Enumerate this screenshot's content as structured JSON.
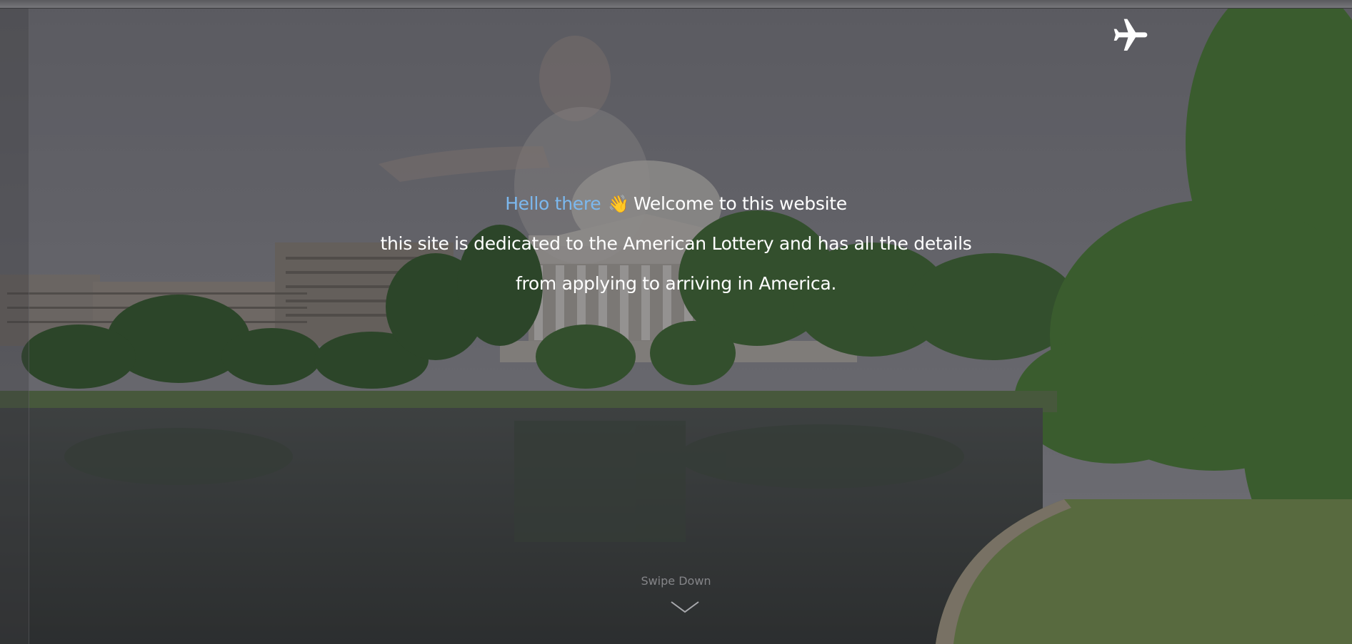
{
  "hero": {
    "greeting_highlight": "Hello there",
    "greeting_emoji": "👋",
    "greeting_rest": "Welcome to this website",
    "line2": "this site is dedicated to the American Lottery and has all the details",
    "line3": "from applying to arriving in America.",
    "swipe_label": "Swipe Down"
  },
  "nav": {
    "plane_icon": "airplane-icon"
  },
  "colors": {
    "accent": "#7cb8ee",
    "text": "#ffffff",
    "overlay": "#28282e"
  }
}
